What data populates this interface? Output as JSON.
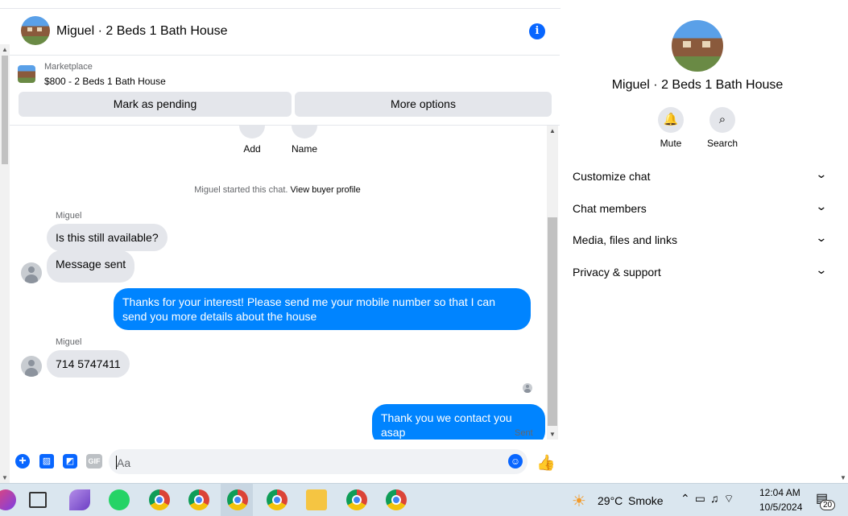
{
  "chat_header": {
    "title": "Miguel · 2 Beds 1 Bath House",
    "info_icon": "i"
  },
  "marketplace": {
    "label": "Marketplace",
    "listing": "$800 - 2 Beds 1 Bath House",
    "mark_pending": "Mark as pending",
    "more_options": "More options"
  },
  "quick_actions": [
    {
      "label": "Add"
    },
    {
      "label": "Name"
    }
  ],
  "conversation": {
    "started_prefix": "Miguel started this chat. ",
    "started_link": "View buyer profile",
    "sender1": "Miguel",
    "msg1": "Is this still available?",
    "msg2": "Message sent",
    "msg3": "Thanks for your interest! Please send me your mobile number so that I can send you more details about the house",
    "sender2": "Miguel",
    "msg4": "714 5747411",
    "msg5": "Thank you we contact you asap",
    "status": "Sent"
  },
  "composer": {
    "placeholder": "Aa",
    "gif_label": "GIF"
  },
  "right_panel": {
    "title": "Miguel · 2 Beds 1 Bath House",
    "mute": "Mute",
    "search": "Search",
    "sections": [
      "Customize chat",
      "Chat members",
      "Media, files and links",
      "Privacy & support"
    ]
  },
  "taskbar": {
    "temperature": "29°C",
    "weather": "Smoke",
    "time": "12:04 AM",
    "date": "10/5/2024",
    "notifications": "20"
  },
  "colors": {
    "accent": "#0866ff",
    "outgoing_bubble": "#0084ff",
    "incoming_bubble": "#e4e6eb"
  }
}
